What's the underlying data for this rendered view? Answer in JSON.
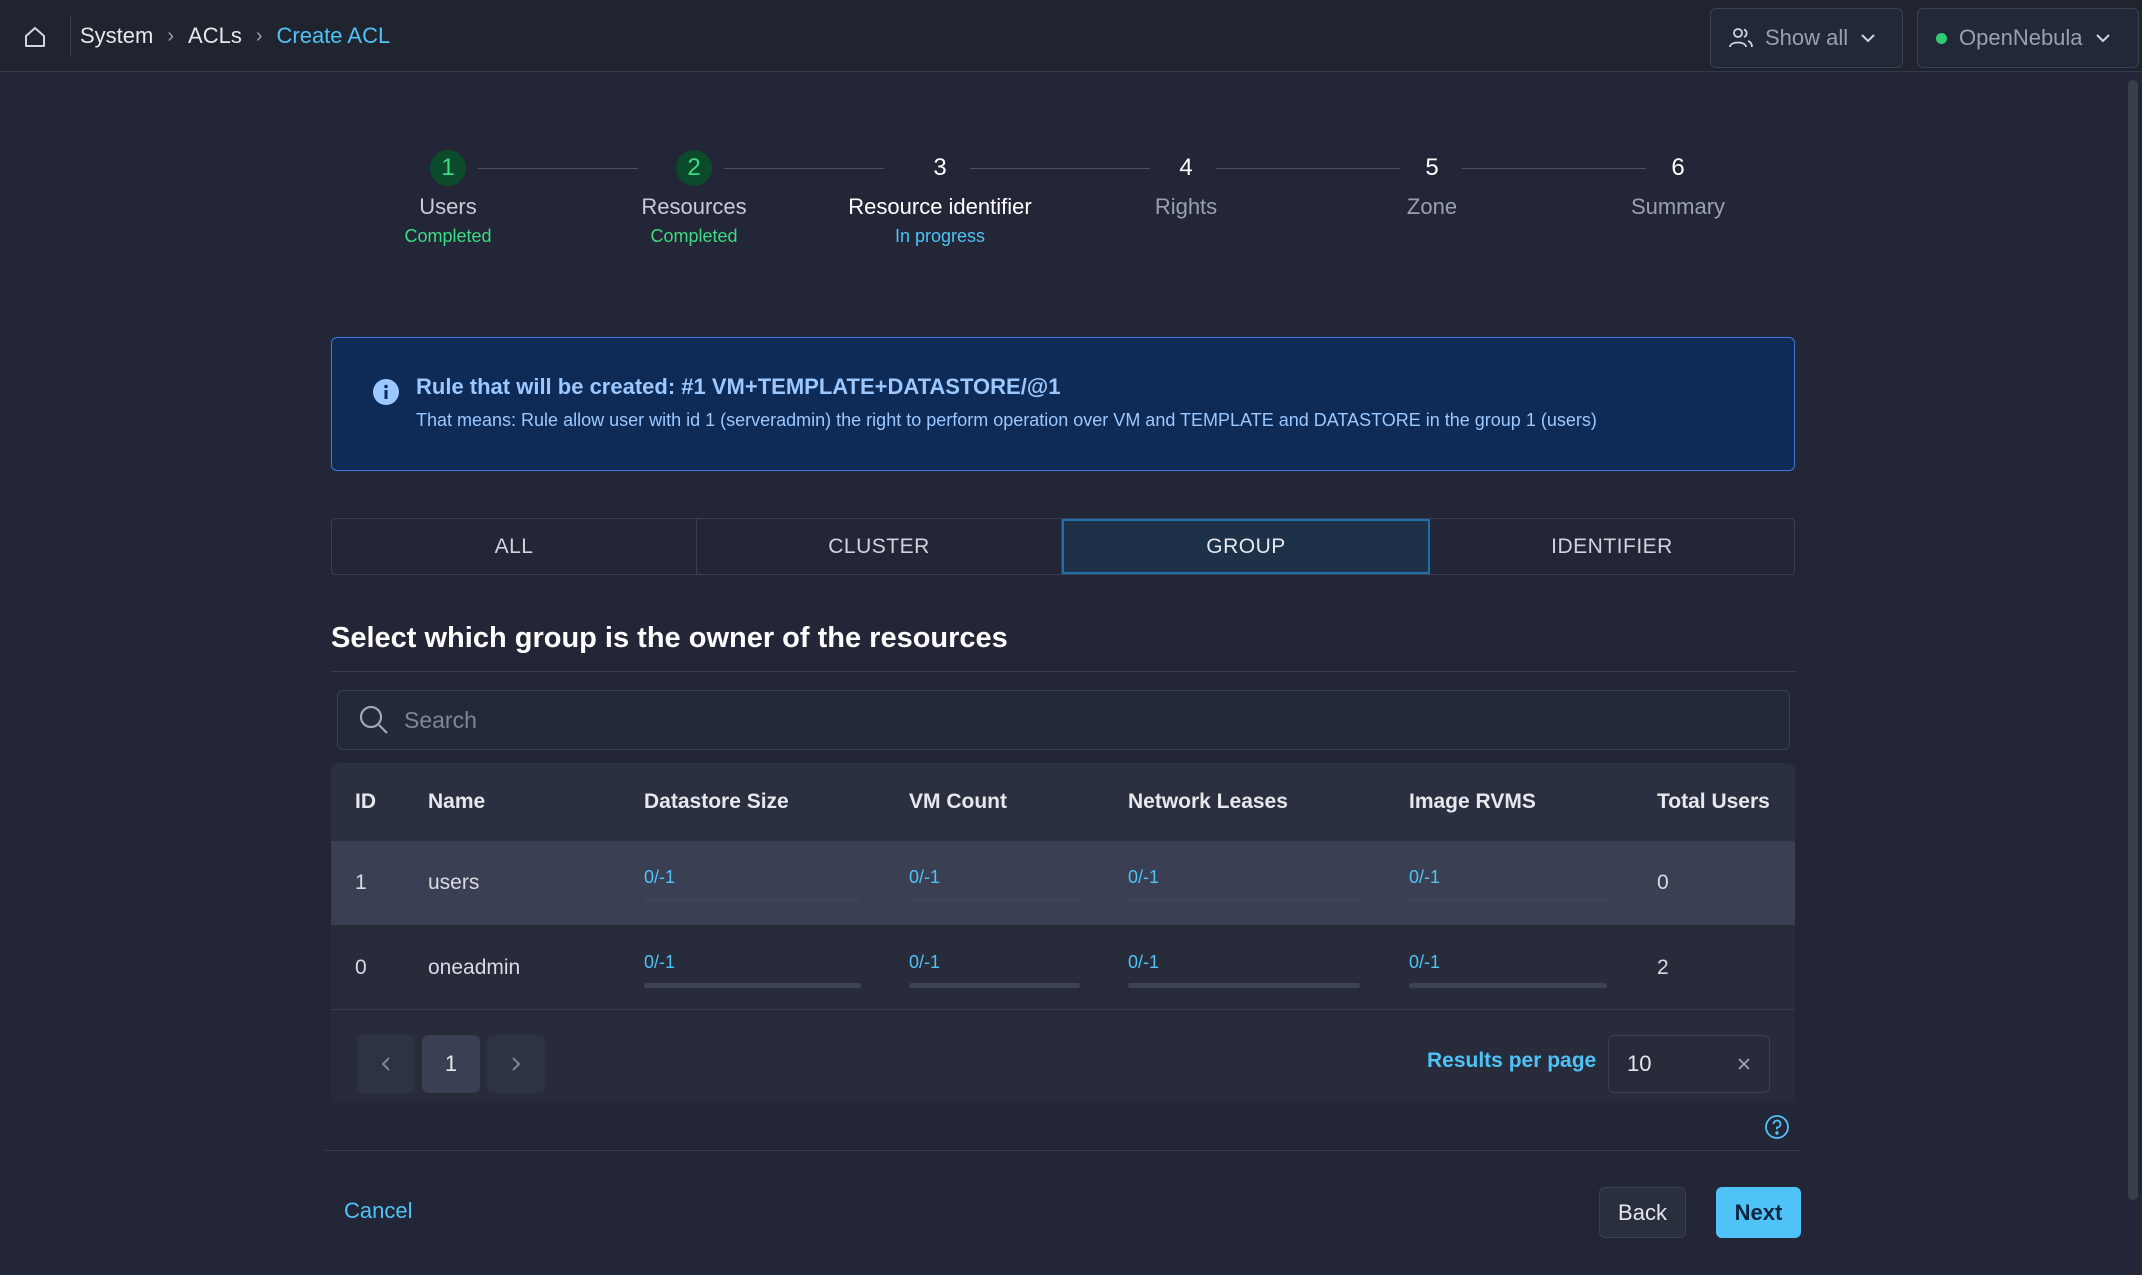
{
  "topbar": {
    "home_icon": "home-icon",
    "breadcrumbs": [
      "System",
      "ACLs",
      "Create ACL"
    ],
    "show_all_label": "Show all",
    "zone_label": "OpenNebula",
    "zone_status_color": "#2ecc71"
  },
  "stepper": {
    "steps": [
      {
        "num": "1",
        "label": "Users",
        "status": "Completed",
        "state": "completed"
      },
      {
        "num": "2",
        "label": "Resources",
        "status": "Completed",
        "state": "completed"
      },
      {
        "num": "3",
        "label": "Resource identifier",
        "status": "In progress",
        "state": "current"
      },
      {
        "num": "4",
        "label": "Rights",
        "status": "",
        "state": "pending"
      },
      {
        "num": "5",
        "label": "Zone",
        "status": "",
        "state": "pending"
      },
      {
        "num": "6",
        "label": "Summary",
        "status": "",
        "state": "pending"
      }
    ]
  },
  "info": {
    "title": "Rule that will be created: #1 VM+TEMPLATE+DATASTORE/@1",
    "description": "That means: Rule allow user with id 1 (serveradmin) the right to perform operation over VM and TEMPLATE and DATASTORE in the group 1 (users)"
  },
  "tabs": [
    {
      "label": "ALL",
      "selected": false
    },
    {
      "label": "CLUSTER",
      "selected": false
    },
    {
      "label": "GROUP",
      "selected": true
    },
    {
      "label": "IDENTIFIER",
      "selected": false
    }
  ],
  "section_title": "Select which group is the owner of the resources",
  "search": {
    "placeholder": "Search",
    "value": ""
  },
  "table": {
    "columns": [
      "ID",
      "Name",
      "Datastore Size",
      "VM Count",
      "Network Leases",
      "Image RVMS",
      "Total Users"
    ],
    "rows": [
      {
        "id": "1",
        "name": "users",
        "datastore": "0/-1",
        "vm": "0/-1",
        "network": "0/-1",
        "image": "0/-1",
        "users": "0",
        "usage_fraction": 0,
        "selected": true
      },
      {
        "id": "0",
        "name": "oneadmin",
        "datastore": "0/-1",
        "vm": "0/-1",
        "network": "0/-1",
        "image": "0/-1",
        "users": "2",
        "usage_fraction": 0,
        "selected": false
      }
    ]
  },
  "pagination": {
    "current_page": "1",
    "prev_icon": "chevron-left-icon",
    "next_icon": "chevron-right-icon",
    "results_per_page_label": "Results per page",
    "results_per_page_value": "10"
  },
  "footer": {
    "cancel_label": "Cancel",
    "back_label": "Back",
    "next_label": "Next"
  },
  "colors": {
    "accent": "#4fc3f7",
    "completed": "#3ddc84",
    "info_bg": "#0e2a57",
    "background": "#222636"
  }
}
